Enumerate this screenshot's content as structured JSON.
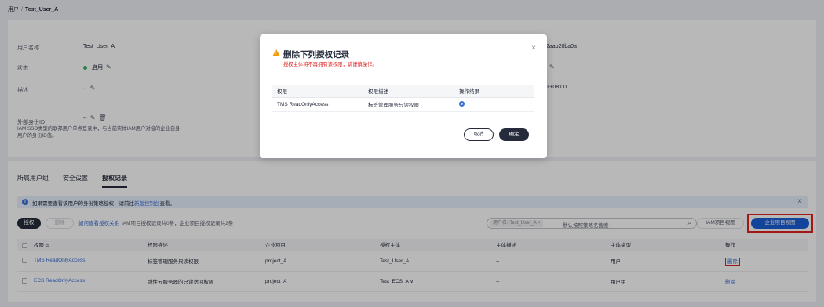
{
  "breadcrumb": {
    "root": "用户",
    "separator": "/",
    "current": "Test_User_A"
  },
  "user_info": {
    "username_label": "用户名称",
    "username_value": "Test_User_A",
    "status_label": "状态",
    "status_value": "启用",
    "desc_label": "描述",
    "desc_value": "--",
    "ext_id_label": "外部身份ID",
    "ext_id_value": "--",
    "ext_id_hint": "IAM SSO类型的联邦用户单点登录中，与当前实体IAM用户对接的企业自身用户的身份ID值。",
    "right_id_partial": "2aab20ba0a",
    "right_tz_partial": "T+08:00"
  },
  "tabs": [
    {
      "label": "所属用户组"
    },
    {
      "label": "安全设置"
    },
    {
      "label": "授权记录"
    }
  ],
  "info_bar": {
    "text": "如果需要查看该用户的身份策略授权，请前往",
    "link": "新版控制台",
    "suffix": "查看。",
    "close": "×"
  },
  "toolbar": {
    "grant": "授权",
    "delete": "删除",
    "help_link": "如何查看授权关系",
    "help_text": "IAM项目授权记录共0条，企业项目授权记录共2条",
    "search_chip": "用户名: Test_User_A  ×",
    "search_placeholder": "默认按照策略名搜索",
    "iam_view": "IAM项目视图",
    "enterprise_view": "企业项目视图"
  },
  "table": {
    "headers": [
      "权限 ⊖",
      "权限描述",
      "企业项目",
      "授权主体",
      "主体描述",
      "主体类型",
      "操作"
    ],
    "rows": [
      {
        "perm": "TMS ReadOnlyAccess",
        "desc": "标签管理服务只读权限",
        "project": "project_A",
        "principal": "Test_User_A",
        "principal_desc": "--",
        "type": "用户",
        "action": "删除"
      },
      {
        "perm": "ECS ReadOnlyAccess",
        "desc": "弹性云服务器的只读访问权限",
        "project": "project_A",
        "principal": "Test_ECS_A ∨",
        "principal_desc": "--",
        "type": "用户组",
        "action": "删除"
      }
    ]
  },
  "modal": {
    "title": "删除下列授权记录",
    "subtitle": "授权主体将不再拥有该权限，请谨慎操作。",
    "close": "×",
    "headers": [
      "权限",
      "权限描述",
      "操作结果"
    ],
    "row": {
      "perm": "TMS ReadOnlyAccess",
      "desc": "标签管理服务只读权限"
    },
    "cancel": "取消",
    "confirm": "确定"
  },
  "colors": {
    "primary": "#1a5fd9",
    "dark": "#252b3a",
    "danger": "#e0221f",
    "warning": "#f29b0d",
    "success": "#3ab46c"
  }
}
